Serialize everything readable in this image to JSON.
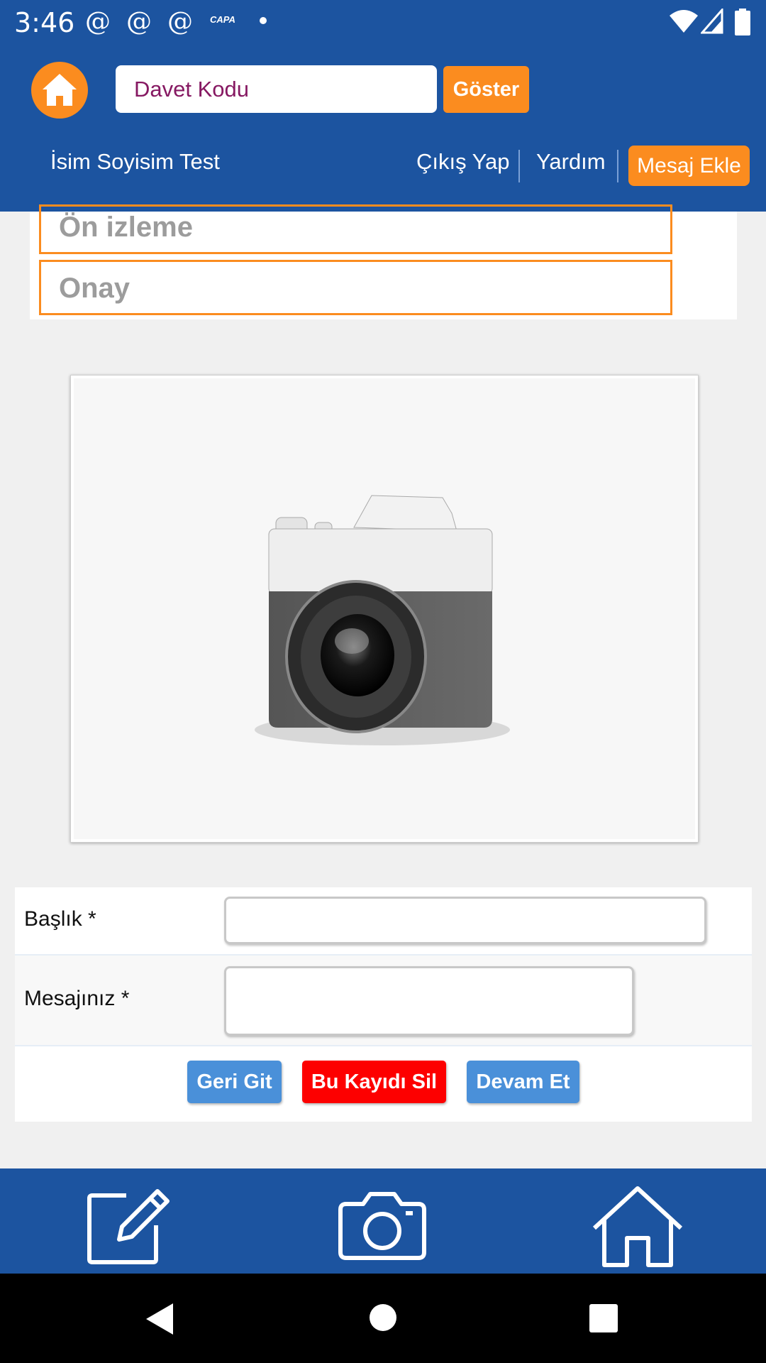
{
  "status_bar": {
    "time": "3:46",
    "notifications": [
      "@",
      "@",
      "@"
    ],
    "capa_label": "CAPA",
    "icons": [
      "wifi-icon",
      "signal-icon",
      "battery-icon"
    ]
  },
  "header": {
    "invite_placeholder": "Davet Kodu",
    "show_button": "Göster",
    "user_name": "İsim Soyisim Test",
    "logout": "Çıkış Yap",
    "help": "Yardım",
    "add_message": "Mesaj Ekle"
  },
  "steps": [
    "Ön izleme",
    "Onay"
  ],
  "form": {
    "title_label": "Başlık *",
    "title_value": "",
    "message_label": "Mesajınız *",
    "message_value": ""
  },
  "buttons": {
    "back": "Geri Git",
    "delete": "Bu Kayıdı Sil",
    "continue": "Devam Et"
  },
  "colors": {
    "primary_blue": "#1c54a0",
    "accent_orange": "#fb8c1f",
    "button_blue": "#4a90d9",
    "button_red": "#fd0000"
  },
  "bottom_nav": [
    "edit-icon",
    "camera-icon",
    "home-icon"
  ],
  "system_nav": [
    "back-icon",
    "home-circle-icon",
    "recents-icon"
  ]
}
